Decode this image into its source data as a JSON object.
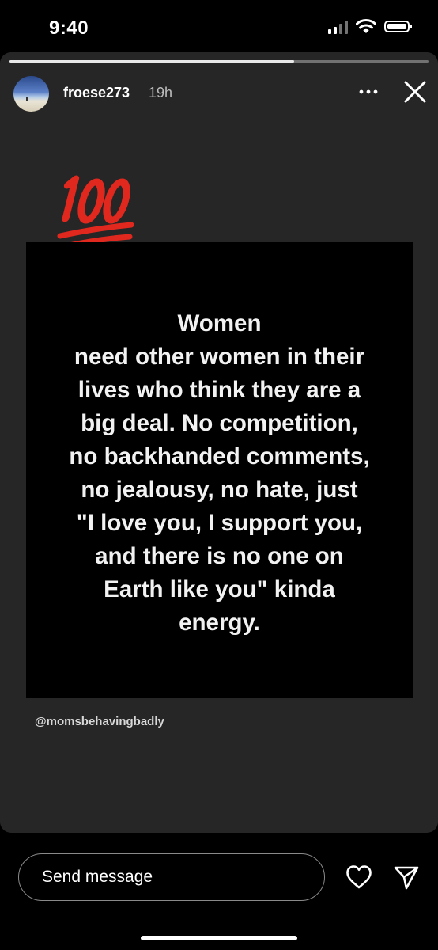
{
  "status_bar": {
    "time": "9:40"
  },
  "story": {
    "progress": 0.68,
    "username": "froese273",
    "time_ago": "19h",
    "emoji": "100",
    "quote_lines": [
      "Women",
      "need other women in their",
      "lives who think they are a",
      "big deal. No competition,",
      "no backhanded comments,",
      "no jealousy, no hate, just",
      "\"I love you, I support you,",
      "and there is no one on",
      "Earth like you\" kinda",
      "energy."
    ],
    "credit": "@momsbehavingbadly"
  },
  "message_bar": {
    "placeholder": "Send message"
  },
  "icons": {
    "more": "more-icon",
    "close": "close-icon",
    "heart": "heart-icon",
    "send": "send-icon"
  },
  "colors": {
    "story_bg": "#262626",
    "emoji_red": "#e0281e"
  }
}
